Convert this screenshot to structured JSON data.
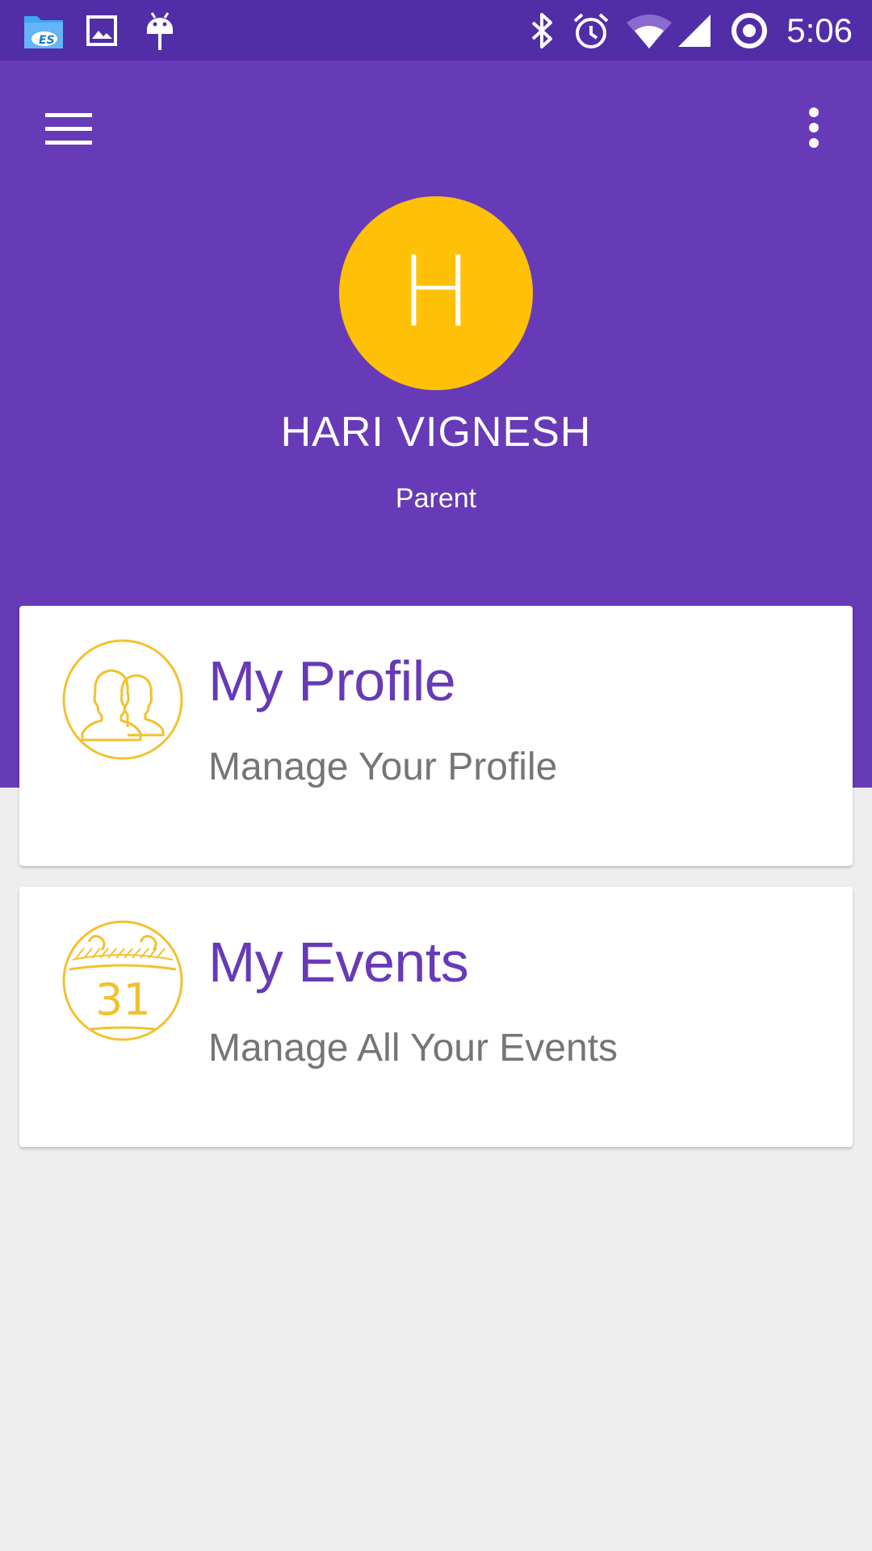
{
  "status_bar": {
    "time": "5:06",
    "left_icons": [
      "es-file-explorer-icon",
      "image-icon",
      "android-debug-icon"
    ],
    "right_icons": [
      "bluetooth-icon",
      "alarm-icon",
      "wifi-icon",
      "cell-signal-icon",
      "sync-icon"
    ]
  },
  "toolbar": {
    "menu_icon": "hamburger-menu-icon",
    "overflow_icon": "more-vert-icon"
  },
  "profile": {
    "initial": "H",
    "name": "HARI VIGNESH",
    "role": "Parent"
  },
  "cards": [
    {
      "title": "My Profile",
      "subtitle": "Manage Your Profile",
      "icon": "users-icon"
    },
    {
      "title": "My Events",
      "subtitle": "Manage All Your Events",
      "icon": "calendar-icon",
      "icon_text": "31"
    }
  ],
  "colors": {
    "status_bar": "#512da8",
    "primary": "#673ab7",
    "accent": "#ffc107",
    "icon_outline": "#f2c12e",
    "subtitle": "#757575",
    "background": "#eeeeee"
  }
}
